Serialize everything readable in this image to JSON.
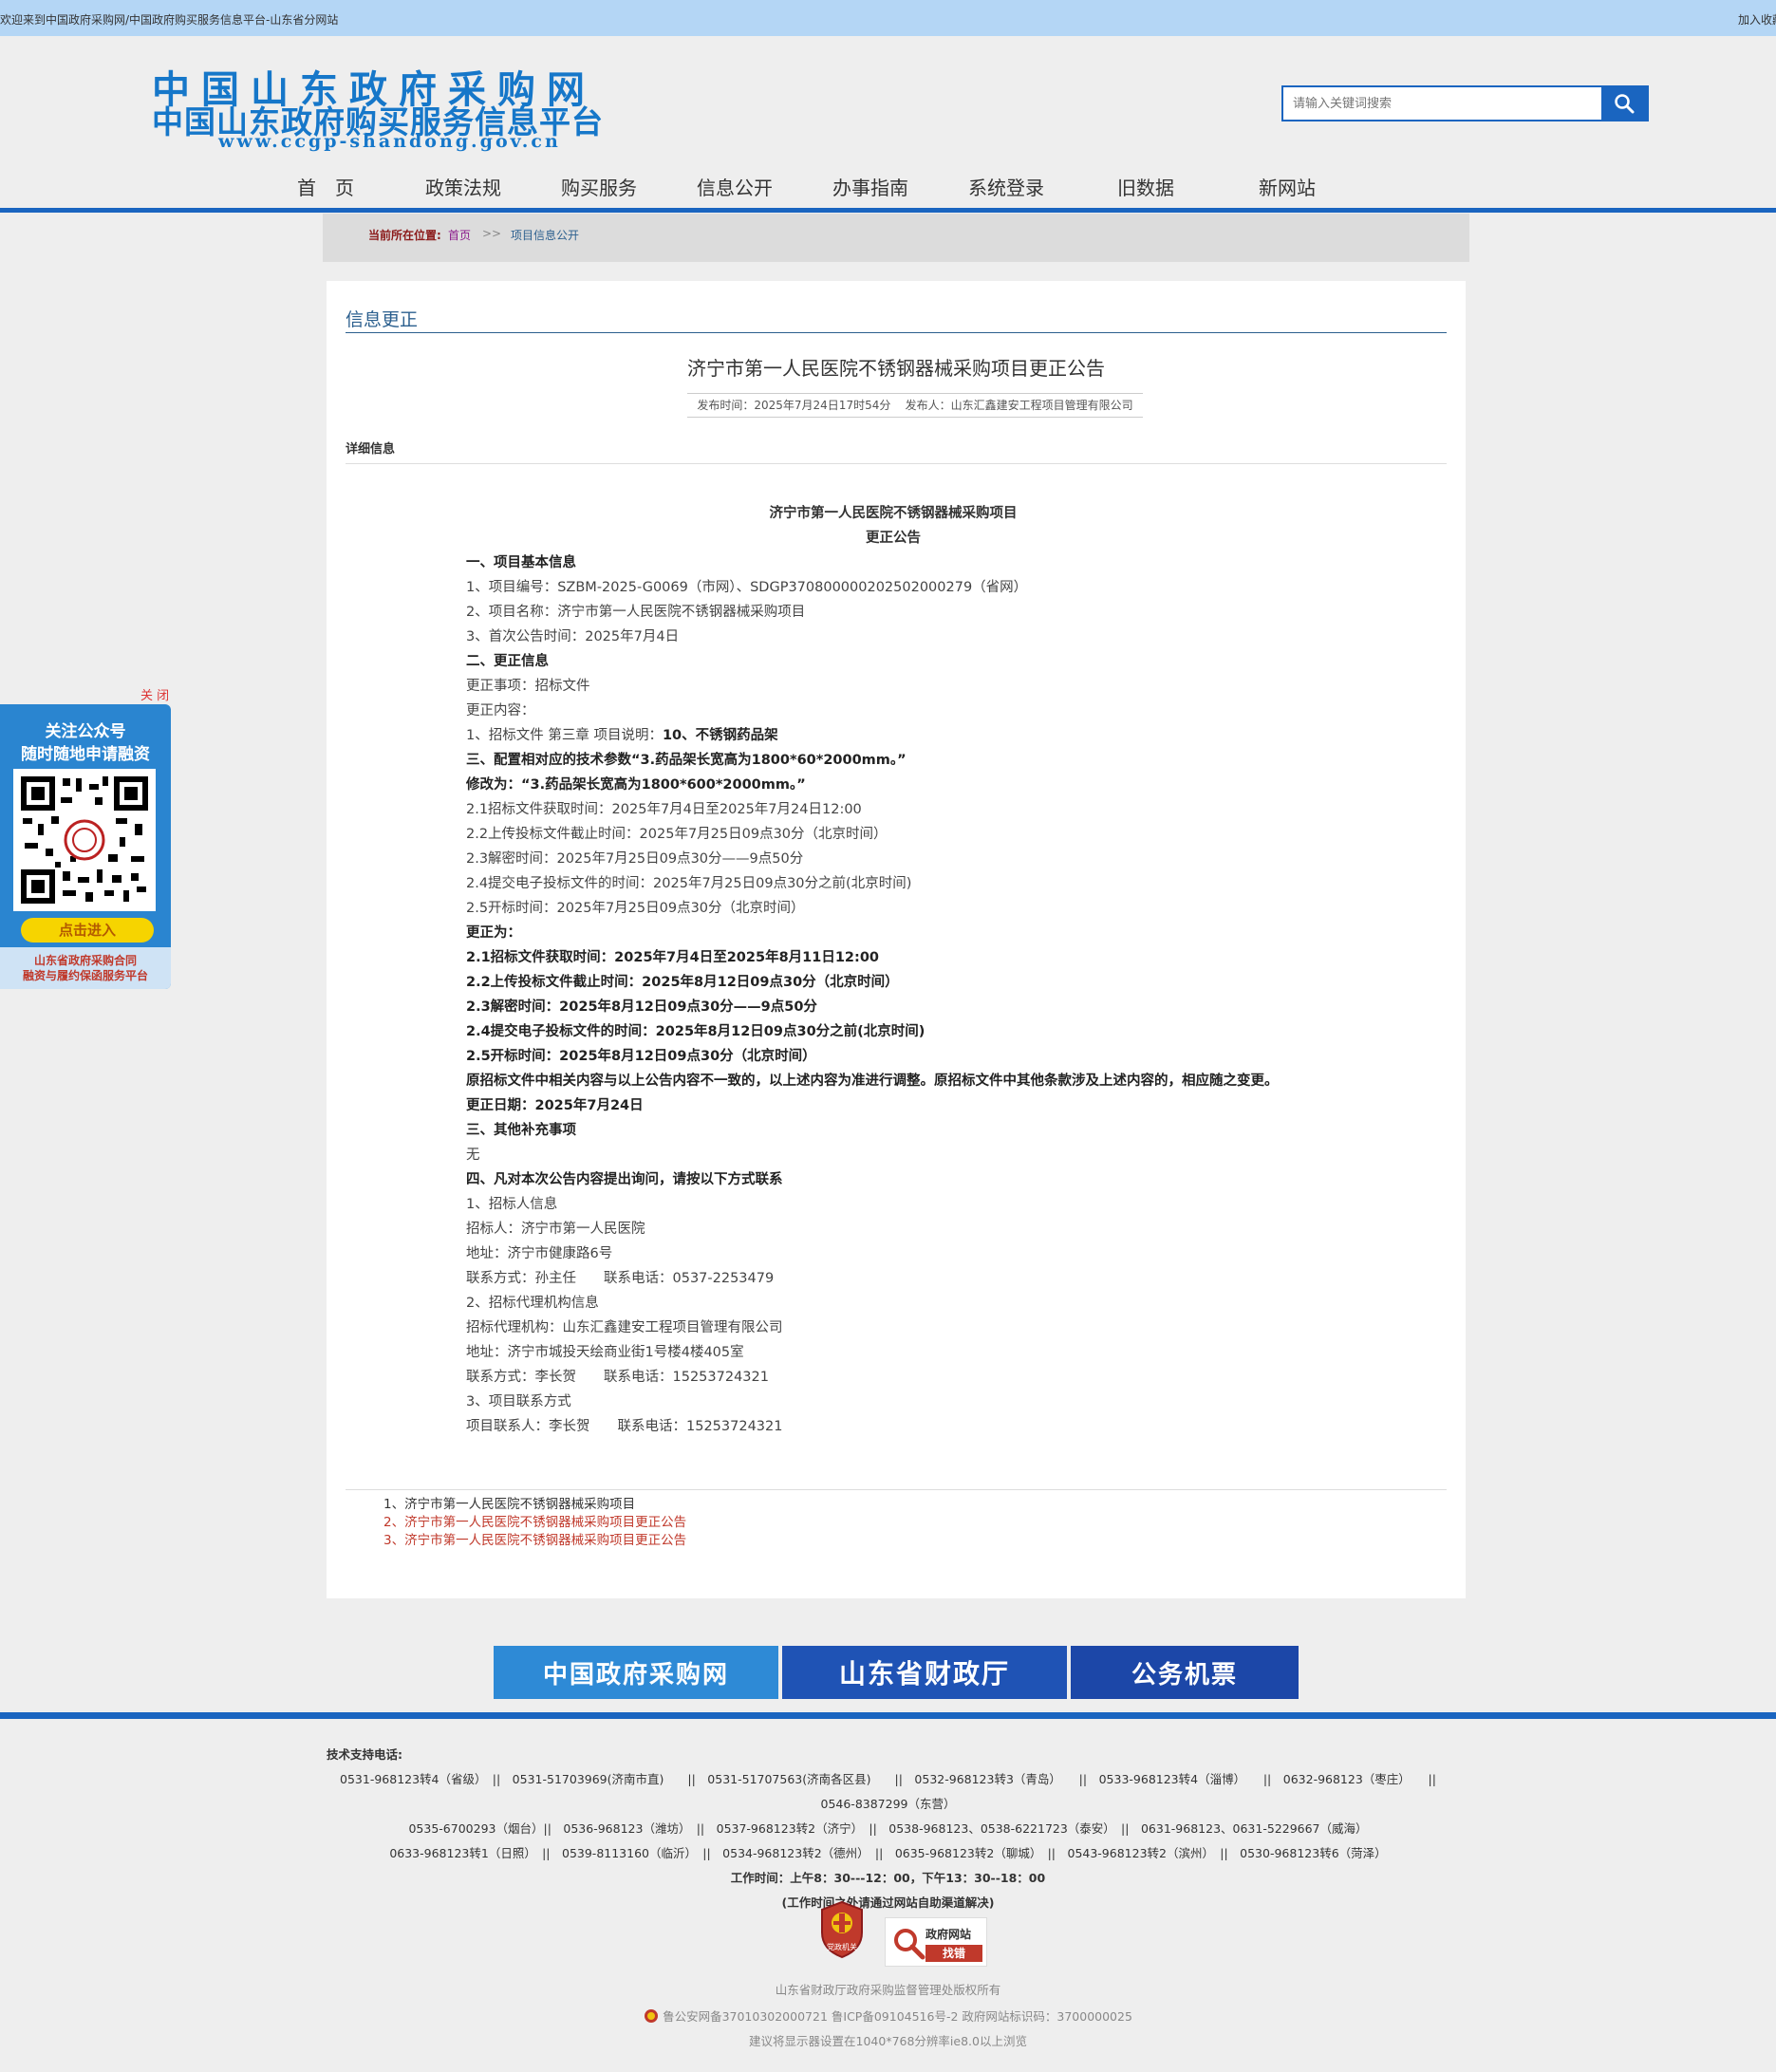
{
  "topbar": {
    "welcome": "欢迎来到中国政府采购网/中国政府购买服务信息平台-山东省分网站",
    "favorite": "加入收藏"
  },
  "header": {
    "logo_line1": "中国山东政府采购网",
    "logo_line2": "中国山东政府购买服务信息平台",
    "logo_line3": "www.ccgp-shandong.gov.cn",
    "search_placeholder": "请输入关键词搜索"
  },
  "nav": [
    "首　页",
    "政策法规",
    "购买服务",
    "信息公开",
    "办事指南",
    "系统登录",
    "旧数据",
    "新网站"
  ],
  "breadcrumb": {
    "label": "当前所在位置:",
    "home": "首页",
    "sep": ">>",
    "current": "项目信息公开"
  },
  "section_title": "信息更正",
  "announcement": {
    "title": "济宁市第一人民医院不锈钢器械采购项目更正公告",
    "publish_time": "发布时间：2025年7月24日17时54分",
    "publisher": "发布人：山东汇鑫建安工程项目管理有限公司",
    "detail_label": "详细信息",
    "heading1": "济宁市第一人民医院不锈钢器械采购项目",
    "heading2": "更正公告",
    "lines": [
      {
        "t": "一、项目基本信息",
        "b": true
      },
      {
        "t": "1、项目编号：SZBM-2025-G0069（市网）、SDGP370800000202502000279（省网）",
        "b": false
      },
      {
        "t": "2、项目名称：济宁市第一人民医院不锈钢器械采购项目",
        "b": false
      },
      {
        "t": "3、首次公告时间：2025年7月4日",
        "b": false
      },
      {
        "t": "二、更正信息",
        "b": true
      },
      {
        "t": "更正事项：招标文件",
        "b": false
      },
      {
        "t": "更正内容：",
        "b": false
      },
      {
        "t": "1、招标文件 第三章 项目说明：",
        "b": false,
        "tb": "10、不锈钢药品架"
      },
      {
        "t": "三、配置相对应的技术参数“3.药品架长宽高为1800*60*2000mm。”",
        "b": true
      },
      {
        "t": "修改为：“3.药品架长宽高为1800*600*2000mm。”",
        "b": true
      },
      {
        "t": "2.1招标文件获取时间：2025年7月4日至2025年7月24日12:00",
        "b": false
      },
      {
        "t": "2.2上传投标文件截止时间：2025年7月25日09点30分（北京时间）",
        "b": false
      },
      {
        "t": "2.3解密时间：2025年7月25日09点30分——9点50分",
        "b": false
      },
      {
        "t": "2.4提交电子投标文件的时间：2025年7月25日09点30分之前(北京时间)",
        "b": false
      },
      {
        "t": "2.5开标时间：2025年7月25日09点30分（北京时间）",
        "b": false
      },
      {
        "t": "更正为：",
        "b": true
      },
      {
        "t": "2.1招标文件获取时间：2025年7月4日至2025年8月11日12:00",
        "b": true
      },
      {
        "t": "2.2上传投标文件截止时间：2025年8月12日09点30分（北京时间）",
        "b": true
      },
      {
        "t": "2.3解密时间：2025年8月12日09点30分——9点50分",
        "b": true
      },
      {
        "t": "2.4提交电子投标文件的时间：2025年8月12日09点30分之前(北京时间)",
        "b": true
      },
      {
        "t": "2.5开标时间：2025年8月12日09点30分（北京时间）",
        "b": true
      },
      {
        "t": "原招标文件中相关内容与以上公告内容不一致的，以上述内容为准进行调整。原招标文件中其他条款涉及上述内容的，相应随之变更。",
        "b": true
      },
      {
        "t": "更正日期：2025年7月24日",
        "b": true
      },
      {
        "t": "三、其他补充事项",
        "b": true
      },
      {
        "t": "无",
        "b": false
      },
      {
        "t": "四、凡对本次公告内容提出询问，请按以下方式联系",
        "b": true
      },
      {
        "t": "1、招标人信息",
        "b": false
      },
      {
        "t": "招标人：济宁市第一人民医院",
        "b": false
      },
      {
        "t": "地址：济宁市健康路6号",
        "b": false
      },
      {
        "t": "联系方式：孙主任　　联系电话：0537-2253479",
        "b": false
      },
      {
        "t": "2、招标代理机构信息",
        "b": false
      },
      {
        "t": "招标代理机构：山东汇鑫建安工程项目管理有限公司",
        "b": false
      },
      {
        "t": "地址：济宁市城投天绘商业街1号楼4楼405室",
        "b": false
      },
      {
        "t": "联系方式：李长贺　　联系电话：15253724321",
        "b": false
      },
      {
        "t": "3、项目联系方式",
        "b": false
      },
      {
        "t": "项目联系人：李长贺　　联系电话：15253724321",
        "b": false
      }
    ]
  },
  "related": [
    "1、济宁市第一人民医院不锈钢器械采购项目",
    "2、济宁市第一人民医院不锈钢器械采购项目更正公告",
    "3、济宁市第一人民医院不锈钢器械采购项目更正公告"
  ],
  "float_card": {
    "close": "关 闭",
    "line1": "关注公众号",
    "line2": "随时随地申请融资",
    "enter": "点击进入",
    "cap1": "山东省政府采购合同",
    "cap2": "融资与履约保函服务平台"
  },
  "banners": [
    {
      "text": "中国政府采购网",
      "color": "#2e8ad6"
    },
    {
      "text": "山东省财政厅",
      "color": "#1f53b5"
    },
    {
      "text": "公务机票",
      "color": "#1c47a8"
    }
  ],
  "footer": {
    "support_label": "技术支持电话:",
    "rows": [
      "0531-968123转4（省级）　||　0531-51703969(济南市直)　　||　0531-51707563(济南各区县)　　||　0532-968123转3（青岛）　　||　0533-968123转4（淄博）　　||　0632-968123（枣庄）　　||",
      "0546-8387299（东营）",
      "0535-6700293（烟台）||　0536-968123（潍坊）　||　0537-968123转2（济宁）　||　0538-968123、0538-6221723（泰安）　||　0631-968123、0631-5229667（威海）",
      "0633-968123转1（日照）　||　0539-8113160（临沂）　||　0534-968123转2（德州）　||　0635-968123转2（聊城）　||　0543-968123转2（滨州）　||　0530-968123转6（菏泽）"
    ],
    "hours": "工作时间：上午8：30---12：00，下午13：30--18：00",
    "hours_note": "(工作时间之外请通过网站自助渠道解决)",
    "badge1_text": "党政机关",
    "badge2_line1": "政府网站",
    "badge2_line2": "找错",
    "copyright": "山东省财政厅政府采购监督管理处版权所有",
    "beian": "鲁公安网备37010302000721  鲁ICP备09104516号-2   政府网站标识码：3700000025",
    "browser": "建议将显示器设置在1040*768分辨率ie8.0以上浏览"
  }
}
